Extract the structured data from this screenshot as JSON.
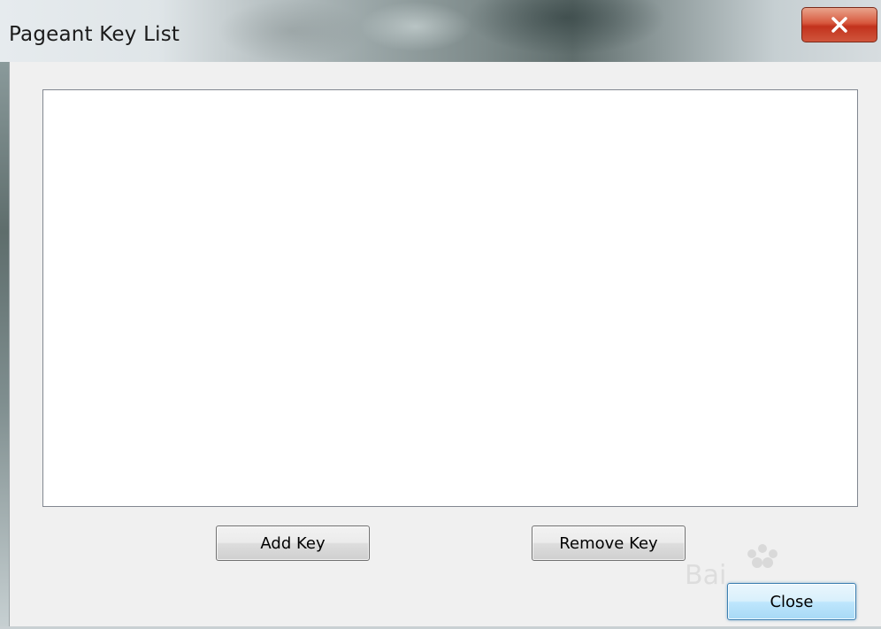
{
  "window": {
    "title": "Pageant Key List",
    "close_icon": "close-x-icon",
    "close_color": "#c9442a"
  },
  "key_list": {
    "items": []
  },
  "buttons": {
    "add_key": "Add Key",
    "remove_key": "Remove Key",
    "close": "Close"
  },
  "watermark": {
    "text": "Bai"
  }
}
